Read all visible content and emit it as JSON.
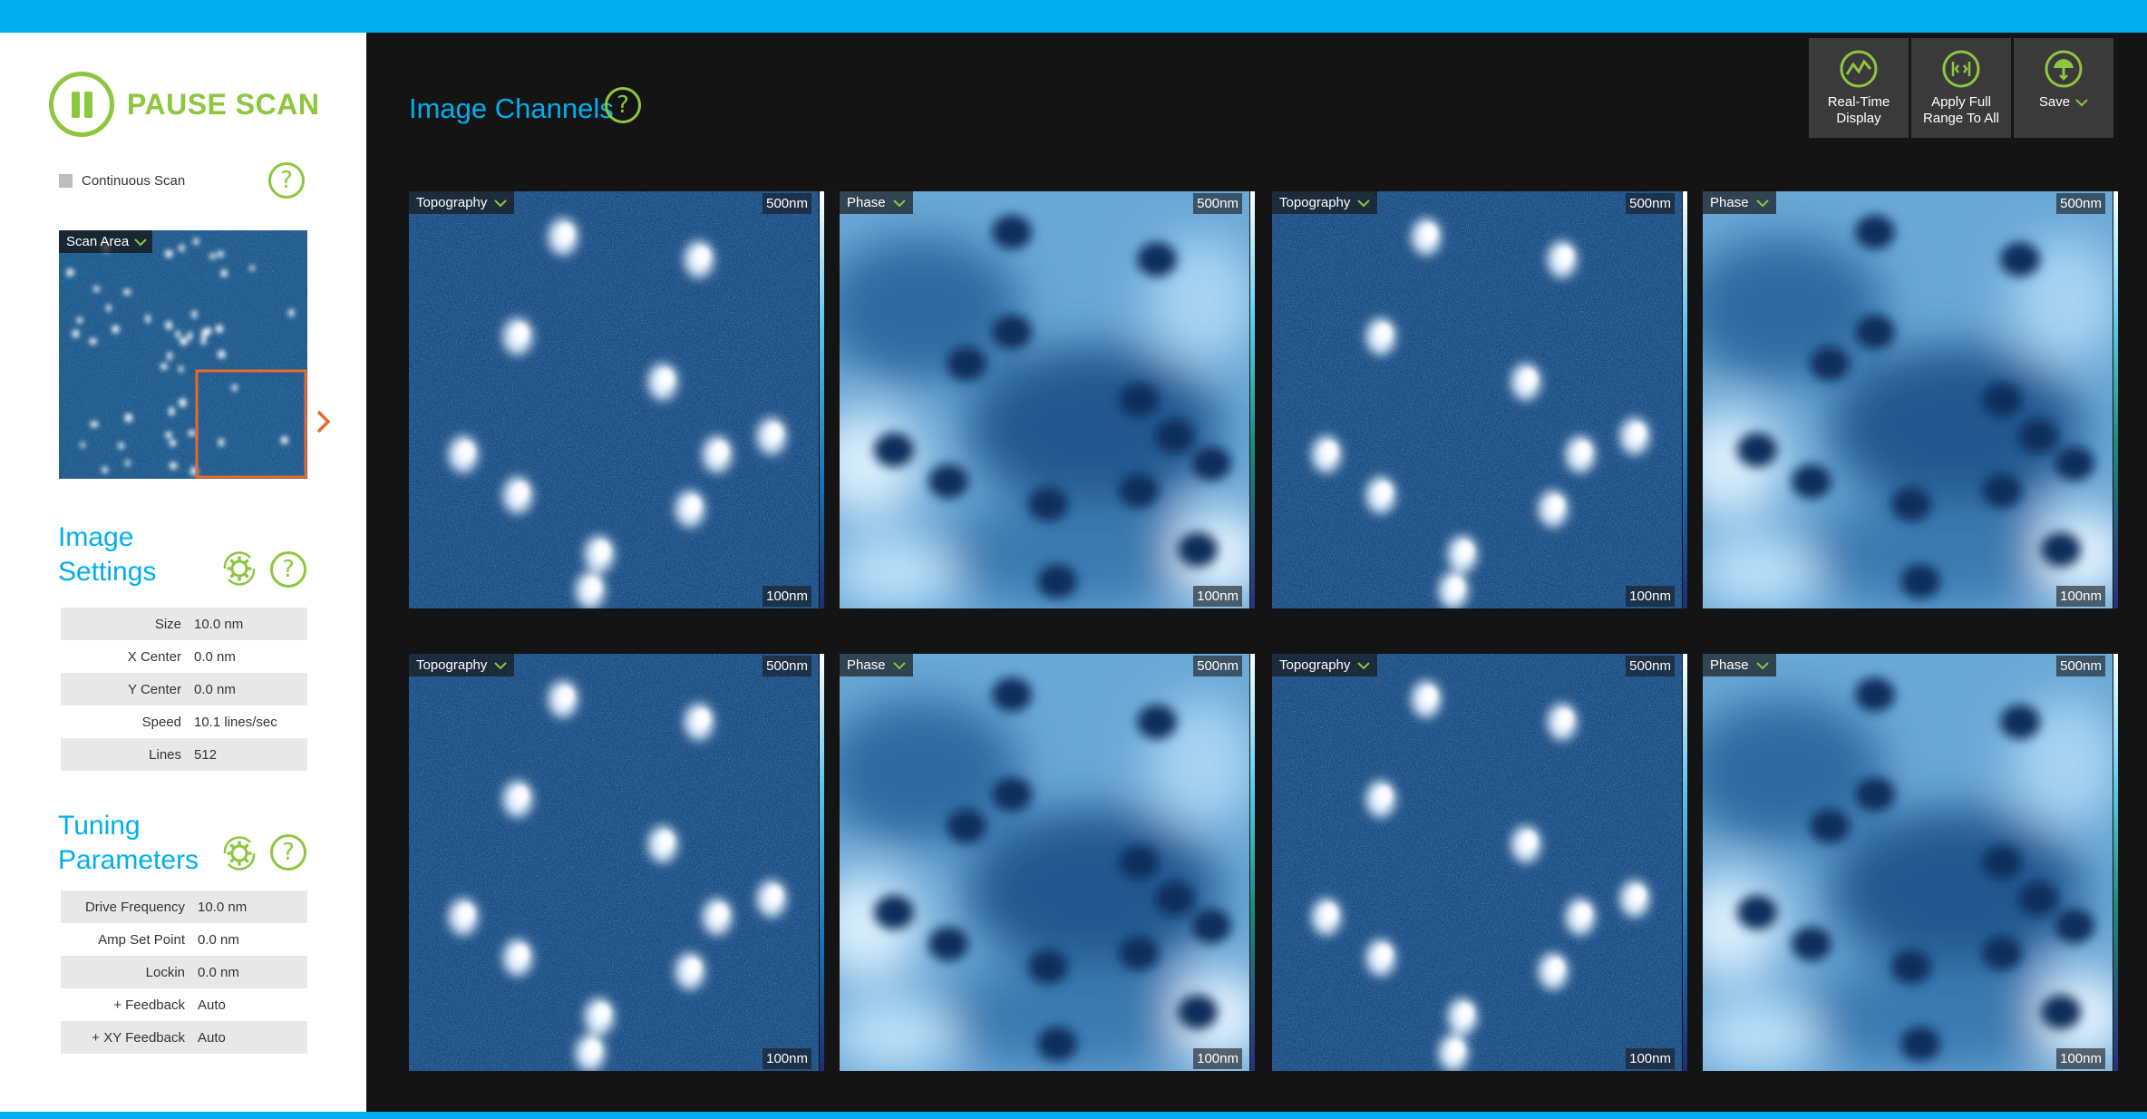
{
  "sidebar": {
    "pause_label": "PAUSE SCAN",
    "continuous_scan_label": "Continuous Scan",
    "scan_area_label": "Scan Area",
    "image_settings_title_line1": "Image",
    "image_settings_title_line2": "Settings",
    "image_settings": [
      {
        "label": "Size",
        "value": "10.0 nm"
      },
      {
        "label": "X Center",
        "value": "0.0 nm"
      },
      {
        "label": "Y Center",
        "value": "0.0 nm"
      },
      {
        "label": "Speed",
        "value": "10.1 lines/sec"
      },
      {
        "label": "Lines",
        "value": "512"
      }
    ],
    "tuning_title_line1": "Tuning",
    "tuning_title_line2": "Parameters",
    "tuning": [
      {
        "label": "Drive Frequency",
        "value": "10.0 nm"
      },
      {
        "label": "Amp Set Point",
        "value": "0.0 nm"
      },
      {
        "label": "Lockin",
        "value": "0.0 nm"
      },
      {
        "label": "+ Feedback",
        "value": "Auto"
      },
      {
        "label": "+ XY Feedback",
        "value": "Auto"
      }
    ]
  },
  "main": {
    "title": "Image Channels",
    "toolbar": [
      {
        "label": "Real-Time\nDisplay",
        "icon": "realtime-icon"
      },
      {
        "label": "Apply Full\nRange To All",
        "icon": "range-icon"
      },
      {
        "label": "Save",
        "icon": "save-icon"
      }
    ],
    "channels": [
      {
        "label": "Topography",
        "scale_top": "500nm",
        "scale_bottom": "100nm",
        "kind": "topo"
      },
      {
        "label": "Phase",
        "scale_top": "500nm",
        "scale_bottom": "100nm",
        "kind": "phase"
      },
      {
        "label": "Topography",
        "scale_top": "500nm",
        "scale_bottom": "100nm",
        "kind": "topo"
      },
      {
        "label": "Phase",
        "scale_top": "500nm",
        "scale_bottom": "100nm",
        "kind": "phase"
      },
      {
        "label": "Topography",
        "scale_top": "500nm",
        "scale_bottom": "100nm",
        "kind": "topo"
      },
      {
        "label": "Phase",
        "scale_top": "500nm",
        "scale_bottom": "100nm",
        "kind": "phase"
      },
      {
        "label": "Topography",
        "scale_top": "500nm",
        "scale_bottom": "100nm",
        "kind": "topo"
      },
      {
        "label": "Phase",
        "scale_top": "500nm",
        "scale_bottom": "100nm",
        "kind": "phase"
      }
    ]
  },
  "colors": {
    "accent_blue": "#00aeef",
    "accent_green": "#8dc63f",
    "selection_orange": "#e8692c"
  }
}
